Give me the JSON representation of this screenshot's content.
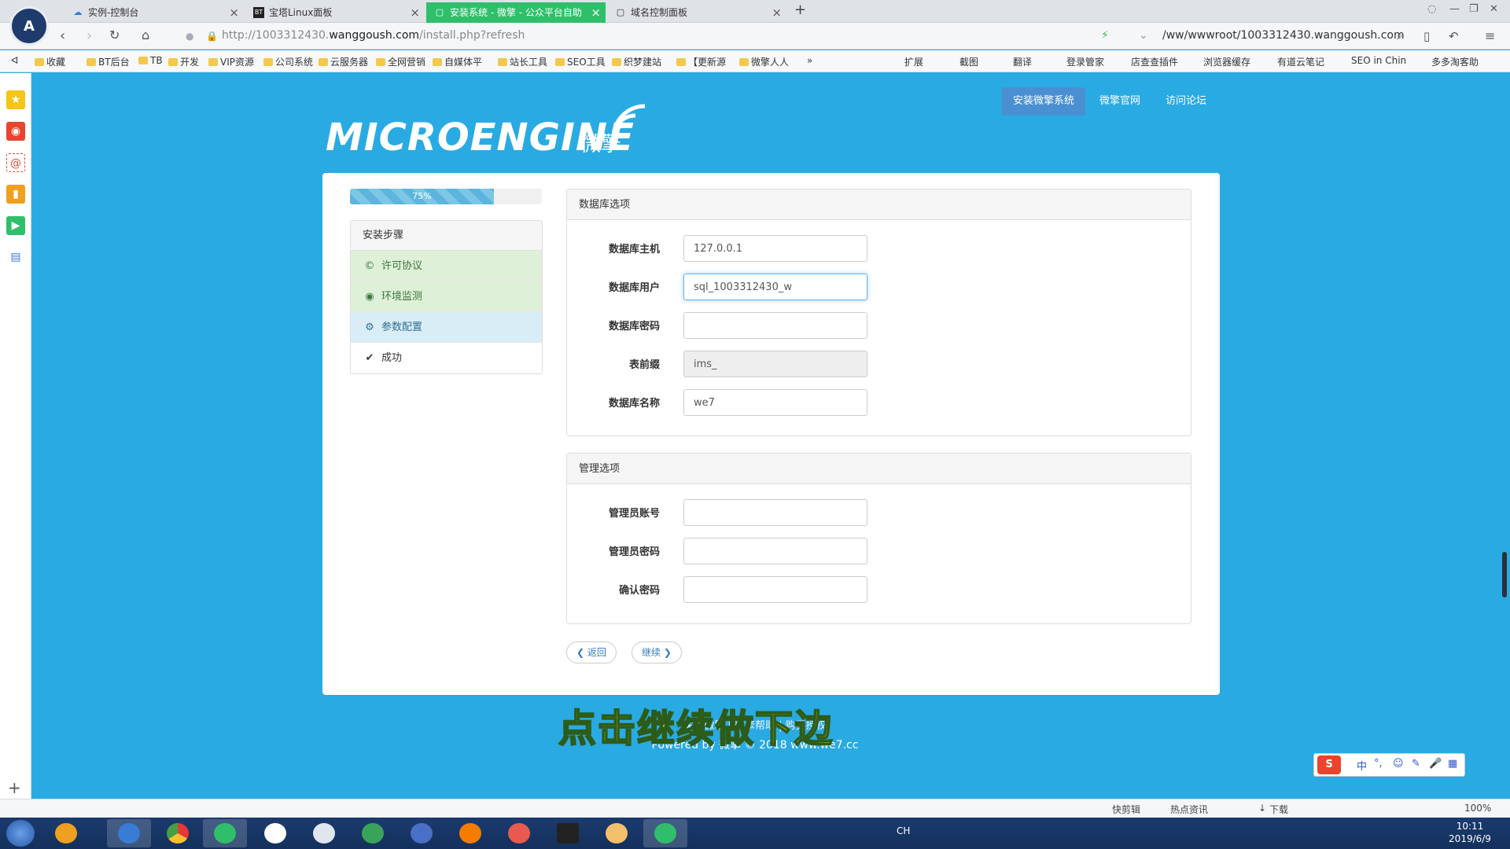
{
  "browser": {
    "tabs": [
      {
        "label": "实例-控制台",
        "icon": "cloud-icon",
        "active": false
      },
      {
        "label": "宝塔Linux面板",
        "icon": "bt-icon",
        "active": false
      },
      {
        "label": "安装系统 - 微擎 - 公众平台自助",
        "icon": "page-icon",
        "active": true
      },
      {
        "label": "域名控制面板",
        "icon": "page-icon",
        "active": false
      }
    ],
    "logo_text": "A",
    "url_prefix": "http://1003312430.",
    "url_host": "wanggoush.com",
    "url_path": "/install.php?refresh",
    "path_box": "/ww/wwwroot/1003312430.wanggoush.com",
    "bookmarks": [
      "收藏",
      "BT后台",
      "TB",
      "开发",
      "VIP资源",
      "公司系统",
      "云服务器",
      "全网营销",
      "自媒体平",
      "站长工具",
      "SEO工具",
      "织梦建站",
      "【更新源",
      "微擎人人"
    ],
    "more": "»",
    "right_bookmarks": [
      "扩展",
      "截图",
      "翻译",
      "登录管家",
      "店查查插件",
      "浏览器缓存",
      "有道云笔记",
      "SEO in Chin",
      "多多淘客助"
    ]
  },
  "header": {
    "brand_text": "MICROENGINE",
    "brand_cn": "微擎",
    "nav": [
      "安装微擎系统",
      "微擎官网",
      "访问论坛"
    ]
  },
  "progress": {
    "label": "75%",
    "value": 0.75
  },
  "steps": {
    "title": "安装步骤",
    "items": [
      {
        "label": "许可协议",
        "icon": "copyright-icon",
        "state": "done"
      },
      {
        "label": "环境监测",
        "icon": "eye-icon",
        "state": "done"
      },
      {
        "label": "参数配置",
        "icon": "gear-icon",
        "state": "current"
      },
      {
        "label": "成功",
        "icon": "check-icon",
        "state": "pending"
      }
    ]
  },
  "db": {
    "title": "数据库选项",
    "fields": [
      {
        "label": "数据库主机",
        "value": "127.0.0.1"
      },
      {
        "label": "数据库用户",
        "value": "sql_1003312430_w"
      },
      {
        "label": "数据库密码",
        "value": ""
      },
      {
        "label": "表前缀",
        "value": "ims_"
      },
      {
        "label": "数据库名称",
        "value": "we7"
      }
    ]
  },
  "admin": {
    "title": "管理选项",
    "fields": [
      {
        "label": "管理员账号",
        "value": ""
      },
      {
        "label": "管理员密码",
        "value": ""
      },
      {
        "label": "确认密码",
        "value": ""
      }
    ]
  },
  "buttons": {
    "back": "返回",
    "next": "继续"
  },
  "footer": {
    "line1": "关于微擎 | 微擎帮助 | 购买授权",
    "line2": "Powered by 微擎 © 2018 www.we7.cc"
  },
  "caption": "点击继续做下边",
  "ime": {
    "items": [
      "中",
      "°,",
      "☺",
      "✎",
      "🎤",
      "▦"
    ]
  },
  "statusbar": {
    "items": [
      "快剪辑",
      "热点资讯",
      "下载",
      "100%"
    ]
  },
  "taskbar": {
    "clock_time": "10:11",
    "clock_date": "2019/6/9",
    "tray_lang": "CH"
  }
}
